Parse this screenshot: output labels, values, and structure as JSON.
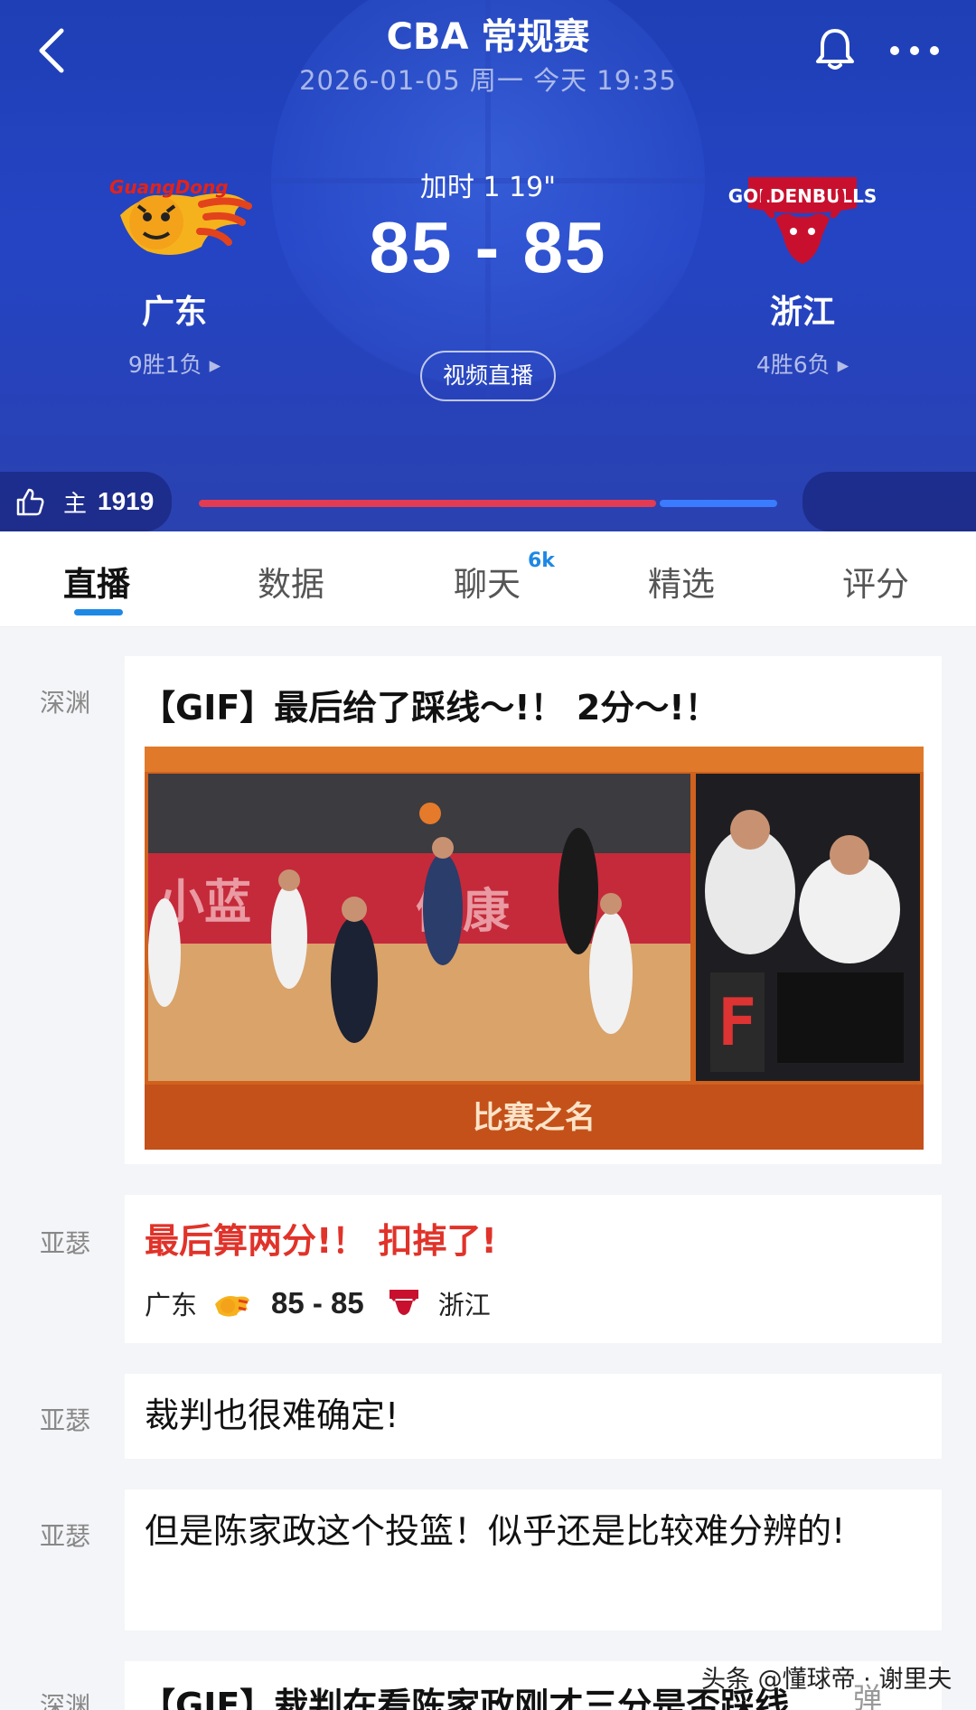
{
  "header": {
    "league": "CBA 常规赛",
    "datetime": "2026-01-05 周一 今天 19:35",
    "status": "加时 1 19\"",
    "score": "85 - 85",
    "live_button": "视频直播",
    "icons": {
      "back": "back-chevron-icon",
      "bell": "bell-icon",
      "more": "more-dots-icon"
    },
    "colors": {
      "background": "#2444c4",
      "home_bar": "#e23b52",
      "away_bar": "#3a7bff"
    }
  },
  "home_team": {
    "name": "广东",
    "record": "9胜1负 ▸",
    "logo": "guangdong-tiger-logo",
    "logo_text": "GuangDong"
  },
  "away_team": {
    "name": "浙江",
    "record": "4胜6负 ▸",
    "logo": "zhejiang-goldenbulls-logo",
    "logo_text": "GOLDENBULLS"
  },
  "support": {
    "side": "主",
    "count": "1919",
    "home_share": 0.79
  },
  "tabs": [
    {
      "label": "直播",
      "active": true
    },
    {
      "label": "数据",
      "active": false
    },
    {
      "label": "聊天",
      "active": false,
      "badge": "6k"
    },
    {
      "label": "精选",
      "active": false
    },
    {
      "label": "评分",
      "active": false
    }
  ],
  "feed": [
    {
      "author": "深渊",
      "title": "【GIF】最后给了踩线～!！ 2分～!！",
      "media_caption": "比赛之名"
    },
    {
      "author": "亚瑟",
      "text": "最后算两分!！ 扣掉了!",
      "home": "广东",
      "score": "85 - 85",
      "away": "浙江"
    },
    {
      "author": "亚瑟",
      "text": "裁判也很难确定!"
    },
    {
      "author": "亚瑟",
      "text": "但是陈家政这个投篮！似乎还是比较难分辨的!"
    },
    {
      "author": "深渊",
      "title": "【GIF】裁判在看陈家政刚才三分是否踩线"
    }
  ],
  "watermark": "头条 @懂球帝 · 谢里夫",
  "float_button": "弹"
}
